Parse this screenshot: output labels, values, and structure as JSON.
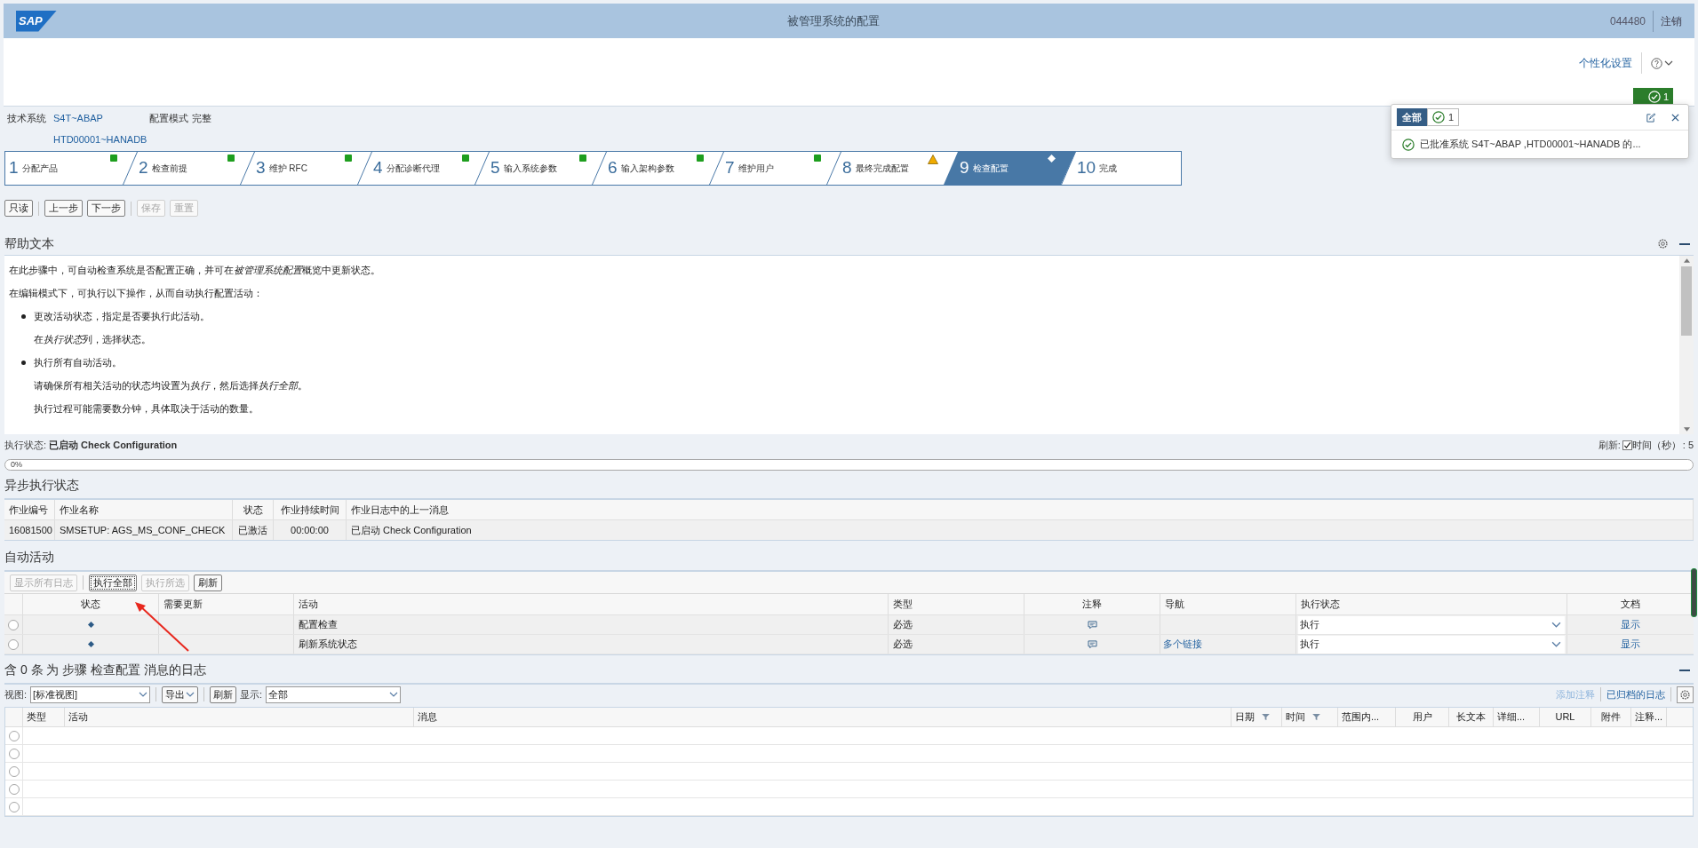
{
  "header": {
    "logo_text": "SAP",
    "title": "被管理系统的配置",
    "user_id": "044480",
    "logout": "注销"
  },
  "shell": {
    "personalize": "个性化设置",
    "message_count": "1"
  },
  "notifications": {
    "tabs": [
      {
        "label": "全部",
        "kind": "all",
        "selected": true
      },
      {
        "label": "1",
        "kind": "success",
        "selected": false
      }
    ],
    "messages": [
      {
        "text": "已批准系统 S4T~ABAP ,HTD00001~HANADB 的..."
      }
    ]
  },
  "info": {
    "tech_system_label": "技术系统",
    "tech_system": "S4T~ABAP",
    "config_mode_label": "配置模式",
    "config_mode": "完整",
    "database": "HTD00001~HANADB"
  },
  "roadmap": [
    {
      "number": "1",
      "label": "分配产品",
      "kind": "done",
      "selected": false
    },
    {
      "number": "2",
      "label": "检查前提",
      "kind": "done",
      "selected": false
    },
    {
      "number": "3",
      "label": "维护 RFC",
      "kind": "done",
      "selected": false
    },
    {
      "number": "4",
      "label": "分配诊断代理",
      "kind": "done",
      "selected": false
    },
    {
      "number": "5",
      "label": "输入系统参数",
      "kind": "done",
      "selected": false
    },
    {
      "number": "6",
      "label": "输入架构参数",
      "kind": "done",
      "selected": false
    },
    {
      "number": "7",
      "label": "维护用户",
      "kind": "done",
      "selected": false
    },
    {
      "number": "8",
      "label": "最终完成配置",
      "kind": "warning",
      "selected": false
    },
    {
      "number": "9",
      "label": "检查配置",
      "kind": "pending",
      "selected": true
    },
    {
      "number": "10",
      "label": "完成",
      "kind": "open",
      "selected": false
    }
  ],
  "toolbar": [
    [
      {
        "label": "只读",
        "disabled": false
      }
    ],
    [
      {
        "label": "上一步",
        "disabled": false
      },
      {
        "label": "下一步",
        "disabled": false
      }
    ],
    [
      {
        "label": "保存",
        "disabled": true
      },
      {
        "label": "重置",
        "disabled": true
      }
    ]
  ],
  "help": {
    "title": "帮助文本",
    "paragraphs": [
      {
        "kind": "para",
        "parts": [
          {
            "text": "在此步骤中，可自动检查系统是否配置正确，并可在",
            "italic": false
          },
          {
            "text": "被管理系统配置",
            "italic": true
          },
          {
            "text": "概览中更新状态。",
            "italic": false
          }
        ]
      },
      {
        "kind": "para",
        "parts": [
          {
            "text": "在编辑模式下，可执行以下操作，从而自动执行配置活动：",
            "italic": false
          }
        ]
      },
      {
        "kind": "bullet",
        "parts": [
          {
            "text": "更改活动状态，指定是否要执行此活动。",
            "italic": false
          }
        ]
      },
      {
        "kind": "indent",
        "parts": [
          {
            "text": "在",
            "italic": false
          },
          {
            "text": "执行状态",
            "italic": true
          },
          {
            "text": "列，选择状态。",
            "italic": false
          }
        ]
      },
      {
        "kind": "bullet",
        "parts": [
          {
            "text": "执行所有自动活动。",
            "italic": false
          }
        ]
      },
      {
        "kind": "indent",
        "parts": [
          {
            "text": "请确保所有相关活动的状态均设置为",
            "italic": false
          },
          {
            "text": "执行",
            "italic": true
          },
          {
            "text": "，然后选择",
            "italic": false
          },
          {
            "text": "执行全部",
            "italic": true
          },
          {
            "text": "。",
            "italic": false
          }
        ]
      },
      {
        "kind": "indent",
        "parts": [
          {
            "text": "执行过程可能需要数分钟，具体取决于活动的数量。",
            "italic": false
          }
        ]
      }
    ]
  },
  "execution": {
    "label": "执行状态:",
    "value": "已启动 Check Configuration",
    "refresh_label": "刷新:",
    "refresh_checked": true,
    "interval_label": "时间（秒）",
    "interval": ": 5",
    "progress_text": "0%",
    "level": 0
  },
  "async": {
    "title": "异步执行状态",
    "columns": [
      "作业编号",
      "作业名称",
      "状态",
      "作业持续时间",
      "作业日志中的上一消息"
    ],
    "rows": [
      [
        "16081500",
        "SMSETUP: AGS_MS_CONF_CHECK",
        "已激活",
        "00:00:00",
        "已启动 Check Configuration"
      ]
    ]
  },
  "auto": {
    "title": "自动活动",
    "toolbar": [
      [
        {
          "label": "显示所有日志",
          "disabled": true,
          "focused": false
        }
      ],
      [
        {
          "label": "执行全部",
          "disabled": false,
          "focused": true
        },
        {
          "label": "执行所选",
          "disabled": true,
          "focused": false
        },
        {
          "label": "刷新",
          "disabled": false,
          "focused": false
        }
      ]
    ],
    "columns": [
      "状态",
      "需要更新",
      "活动",
      "类型",
      "注释",
      "导航",
      "执行状态",
      "文档"
    ],
    "rows": [
      {
        "selected": false,
        "kind": "pending",
        "activity": "配置检查",
        "type": "必选",
        "has_comment": true,
        "exec_status": "执行",
        "doc": "显示"
      },
      {
        "selected": false,
        "kind": "pending",
        "activity": "刷新系统状态",
        "type": "必选",
        "has_comment": true,
        "navigation": "多个链接",
        "exec_status": "执行",
        "doc": "显示"
      }
    ]
  },
  "log": {
    "title": "含 0 条 为 步骤 检查配置 消息的日志",
    "view_label": "视图:",
    "view_value": "[标准视图]",
    "export": "导出",
    "refresh": "刷新",
    "show_label": "显示:",
    "show_value": "全部",
    "add_note": "添加注释",
    "add_note_disabled": true,
    "archived": "已归档的日志",
    "columns": [
      {
        "label": "类型",
        "filter": false
      },
      {
        "label": "活动",
        "filter": false
      },
      {
        "label": "消息",
        "filter": false
      },
      {
        "label": "日期",
        "filter": true
      },
      {
        "label": "时间",
        "filter": true
      },
      {
        "label": "范围内...",
        "filter": false
      },
      {
        "label": "用户",
        "filter": false
      },
      {
        "label": "长文本",
        "filter": false
      },
      {
        "label": "详细...",
        "filter": false
      },
      {
        "label": "URL",
        "filter": false
      },
      {
        "label": "附件",
        "filter": false
      },
      {
        "label": "注释...",
        "filter": false
      }
    ],
    "rows": [
      {
        "selected": false
      },
      {
        "selected": false
      },
      {
        "selected": false
      },
      {
        "selected": false
      },
      {
        "selected": false
      }
    ]
  }
}
